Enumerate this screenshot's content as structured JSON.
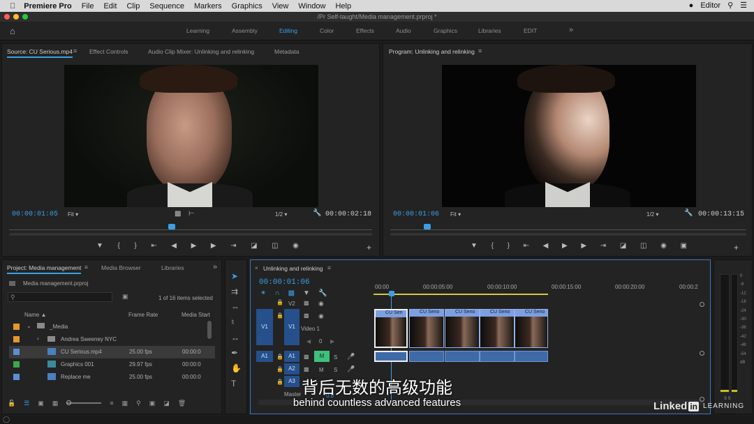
{
  "menubar": {
    "apple": "",
    "app": "Premiere Pro",
    "items": [
      "File",
      "Edit",
      "Clip",
      "Sequence",
      "Markers",
      "Graphics",
      "View",
      "Window",
      "Help"
    ],
    "user": "Editor"
  },
  "title": "/Pr Self-taught/Media management.prproj *",
  "workspaces": [
    "Learning",
    "Assembly",
    "Editing",
    "Color",
    "Effects",
    "Audio",
    "Graphics",
    "Libraries",
    "EDIT"
  ],
  "workspace_more": "»",
  "source": {
    "tabs": [
      "Source: CU Serious.mp4",
      "Effect Controls",
      "Audio Clip Mixer: Unlinking and relinking",
      "Metadata"
    ],
    "timecode": "00:00:01:05",
    "fit": "Fit",
    "res": "1/2",
    "duration": "00:00:02:18"
  },
  "program": {
    "tab": "Program: Unlinking and relinking",
    "timecode": "00:00:01:06",
    "fit": "Fit",
    "res": "1/2",
    "duration": "00:00:13:15"
  },
  "project": {
    "tabs": [
      "Project: Media management",
      "Media Browser",
      "Libraries"
    ],
    "more": "»",
    "file": "Media management.prproj",
    "items_selected": "1 of 16 items selected",
    "search_placeholder": "",
    "columns": [
      "Name",
      "Frame Rate",
      "Media Start"
    ],
    "rows": [
      {
        "name": "_Media",
        "rate": "",
        "start": "",
        "color": "#e8962e"
      },
      {
        "name": "Andrea Sweeney NYC",
        "rate": "",
        "start": "",
        "color": "#e8962e"
      },
      {
        "name": "CU Serious.mp4",
        "rate": "25.00 fps",
        "start": "00:00:0",
        "color": "#5a8fd6"
      },
      {
        "name": "Graphics 001",
        "rate": "29.97 fps",
        "start": "00:00:0",
        "color": "#3aa84a"
      },
      {
        "name": "Replace me",
        "rate": "25.00 fps",
        "start": "00:00:0",
        "color": "#5a8fd6"
      }
    ]
  },
  "timeline": {
    "tab": "Unlinking and relinking",
    "timecode": "00:00:01:06",
    "ruler": [
      "00:00",
      "00:00:05:00",
      "00:00:10:00",
      "00:00:15:00",
      "00:00:20:00",
      "00:00:2"
    ],
    "tracks": {
      "v2": "V2",
      "v1_src": "V1",
      "v1": "V1",
      "v1_name": "Video 1",
      "v1_value": "0",
      "a1_src": "A1",
      "a1": "A1",
      "a2": "A2",
      "a3": "A3",
      "mute": "M",
      "solo": "S",
      "master": "Master",
      "master_val": "0.0"
    },
    "clips": [
      "CU Seri",
      "CU Serio",
      "CU Serio",
      "CU Serio",
      "CU Serio"
    ]
  },
  "meter": {
    "labels": [
      "0",
      "-6",
      "-12",
      "-18",
      "-24",
      "-30",
      "-36",
      "-42",
      "-48",
      "-54",
      "dB"
    ],
    "solo": "S  S"
  },
  "subtitles": {
    "cn": "背后无数的高级功能",
    "en": "behind countless advanced features"
  },
  "watermark": {
    "linked": "Linked",
    "in": "in",
    "learning": "LEARNING"
  }
}
